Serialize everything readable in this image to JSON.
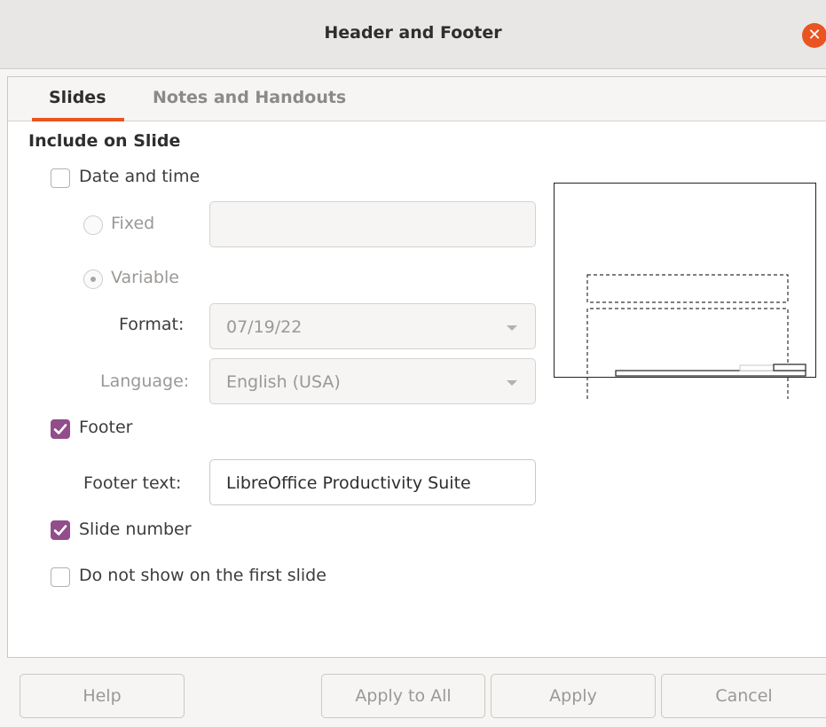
{
  "window": {
    "title": "Header and Footer"
  },
  "tabs": [
    {
      "label": "Slides",
      "active": true
    },
    {
      "label": "Notes and Handouts",
      "active": false
    }
  ],
  "section": {
    "title": "Include on Slide"
  },
  "date_time": {
    "label": "Date and time",
    "checked": false,
    "fixed": {
      "label": "Fixed",
      "value": ""
    },
    "variable": {
      "label": "Variable"
    },
    "format": {
      "label": "Format:",
      "value": "07/19/22"
    },
    "language": {
      "label": "Language:",
      "value": "English (USA)"
    }
  },
  "footer": {
    "label": "Footer",
    "checked": true,
    "text_label": "Footer text:",
    "text_value": "LibreOffice Productivity Suite"
  },
  "slide_number": {
    "label": "Slide number",
    "checked": true
  },
  "first_slide": {
    "label": "Do not show on the first slide",
    "checked": false
  },
  "buttons": {
    "help": "Help",
    "apply_all": "Apply to All",
    "apply": "Apply",
    "cancel": "Cancel"
  },
  "colors": {
    "accent": "#e95420",
    "checkbox": "#924d8b"
  }
}
